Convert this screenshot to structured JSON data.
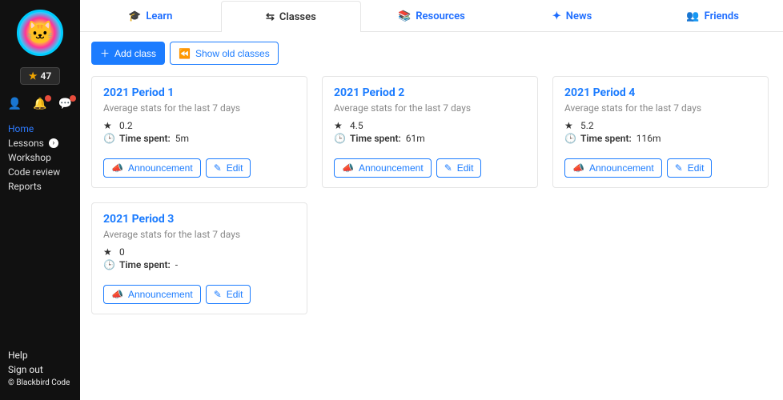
{
  "sidebar": {
    "points": "47",
    "nav": {
      "home": "Home",
      "lessons": "Lessons",
      "workshop": "Workshop",
      "code_review": "Code review",
      "reports": "Reports"
    },
    "bottom": {
      "help": "Help",
      "signout": "Sign out"
    },
    "copyright": "© Blackbird Code"
  },
  "tabs": {
    "learn": "Learn",
    "classes": "Classes",
    "resources": "Resources",
    "news": "News",
    "friends": "Friends"
  },
  "toolbar": {
    "add_class": "Add class",
    "show_old": "Show old classes"
  },
  "common": {
    "avg_label": "Average stats for the last 7 days",
    "time_spent_label": "Time spent:",
    "announce": "Announcement",
    "edit": "Edit"
  },
  "classes": [
    {
      "title": "2021 Period 1",
      "rating": "0.2",
      "time": "5m"
    },
    {
      "title": "2021 Period 2",
      "rating": "4.5",
      "time": "61m"
    },
    {
      "title": "2021 Period 4",
      "rating": "5.2",
      "time": "116m"
    },
    {
      "title": "2021 Period 3",
      "rating": "0",
      "time": "-"
    }
  ]
}
